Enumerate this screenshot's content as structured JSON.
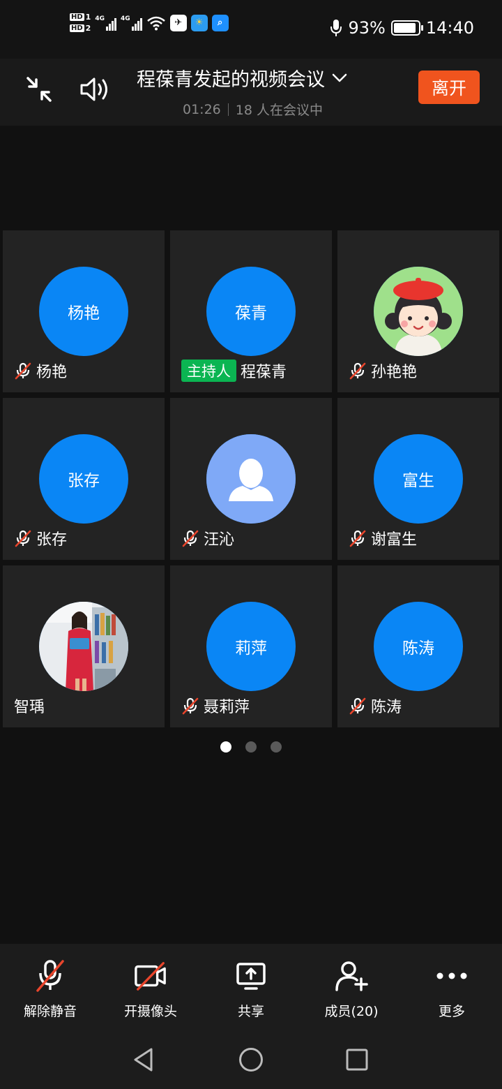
{
  "status_bar": {
    "hd1": "HD",
    "hd1_num": "1",
    "hd2": "HD",
    "hd2_num": "2",
    "net1": "4G",
    "net2": "4G",
    "battery_text": "93%",
    "battery_level": 0.93,
    "time": "14:40",
    "app_icons": [
      "plane-app-icon",
      "weather-app-icon",
      "search-app-icon"
    ]
  },
  "header": {
    "title": "程葆青发起的视频会议",
    "duration": "01:26",
    "participants_text": "18 人在会议中",
    "leave_label": "离开",
    "accent_color": "#f0541e"
  },
  "participants": [
    {
      "avatar_text": "杨艳",
      "name": "杨艳",
      "muted": true,
      "host": false
    },
    {
      "avatar_text": "葆青",
      "name": "程葆青",
      "muted": false,
      "host": true,
      "host_label": "主持人"
    },
    {
      "avatar_text": "",
      "name": "孙艳艳",
      "muted": true,
      "host": false,
      "avatar_icon": "cartoon-girl-avatar"
    },
    {
      "avatar_text": "张存",
      "name": "张存",
      "muted": true,
      "host": false
    },
    {
      "avatar_text": "",
      "name": "汪沁",
      "muted": true,
      "host": false,
      "avatar_icon": "default-person-avatar"
    },
    {
      "avatar_text": "富生",
      "name": "谢富生",
      "muted": true,
      "host": false
    },
    {
      "avatar_text": "",
      "name": "智瑀",
      "muted": false,
      "host": false,
      "avatar_icon": "photo-avatar"
    },
    {
      "avatar_text": "莉萍",
      "name": "聂莉萍",
      "muted": true,
      "host": false
    },
    {
      "avatar_text": "陈涛",
      "name": "陈涛",
      "muted": true,
      "host": false
    }
  ],
  "pager": {
    "pages": 3,
    "current": 1
  },
  "toolbar": {
    "unmute_label": "解除静音",
    "camera_label": "开摄像头",
    "share_label": "共享",
    "members_label": "成员(20)",
    "more_label": "更多"
  },
  "colors": {
    "avatar_blue": "#0a86f5",
    "host_green": "#0bb552",
    "mute_red": "#e8452c"
  }
}
